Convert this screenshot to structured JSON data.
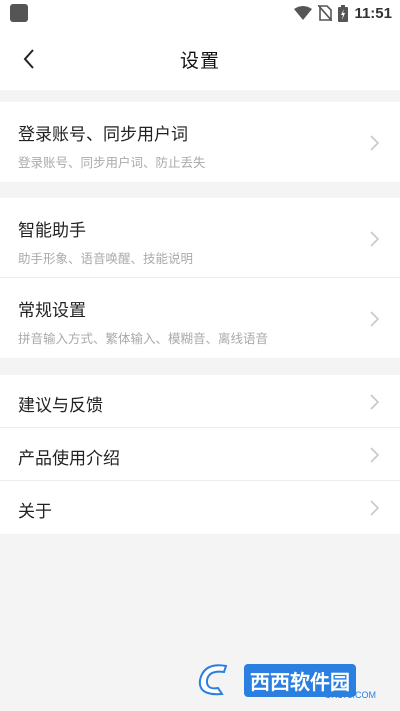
{
  "status_bar": {
    "time": "11:51"
  },
  "navbar": {
    "title": "设置"
  },
  "groups": [
    {
      "items": [
        {
          "label": "登录账号、同步用户词",
          "sub": "登录账号、同步用户词、防止丢失"
        }
      ]
    },
    {
      "items": [
        {
          "label": "智能助手",
          "sub": "助手形象、语音唤醒、技能说明"
        },
        {
          "label": "常规设置",
          "sub": "拼音输入方式、繁体输入、模糊音、离线语音"
        }
      ]
    },
    {
      "items": [
        {
          "label": "建议与反馈"
        },
        {
          "label": "产品使用介绍"
        },
        {
          "label": "关于"
        }
      ]
    }
  ],
  "watermark": {
    "site_name": "西西软件园",
    "domain": "CR173.COM"
  },
  "colors": {
    "background": "#f4f4f4",
    "card": "#ffffff",
    "primary_text": "#222222",
    "secondary_text": "#aaaaaa",
    "chevron": "#c8c8c8"
  }
}
